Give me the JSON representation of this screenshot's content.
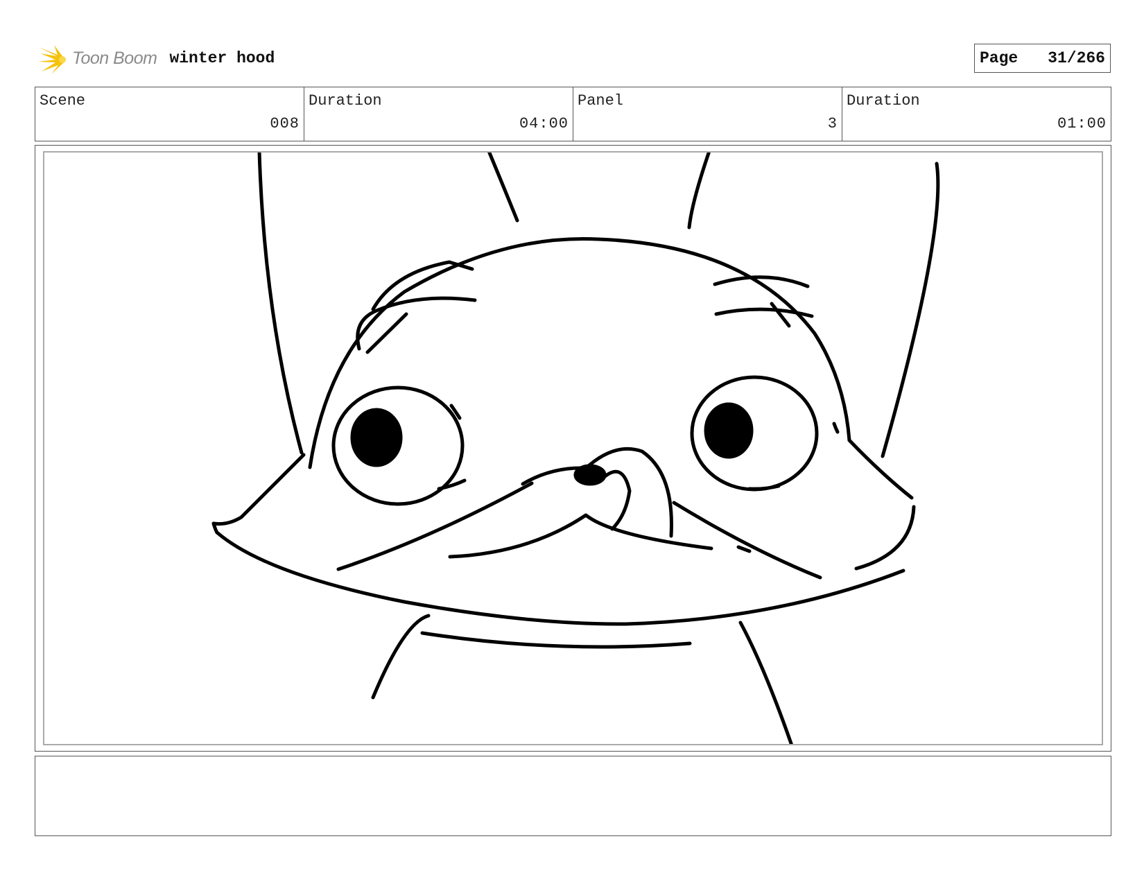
{
  "header": {
    "logo_text": "Toon Boom",
    "project_title": "winter hood",
    "page_label": "Page",
    "page_number": "31/266"
  },
  "info": {
    "scene_label": "Scene",
    "scene_value": "008",
    "scene_duration_label": "Duration",
    "scene_duration_value": "04:00",
    "panel_label": "Panel",
    "panel_value": "3",
    "panel_duration_label": "Duration",
    "panel_duration_value": "01:00"
  },
  "notes": {
    "text": ""
  }
}
